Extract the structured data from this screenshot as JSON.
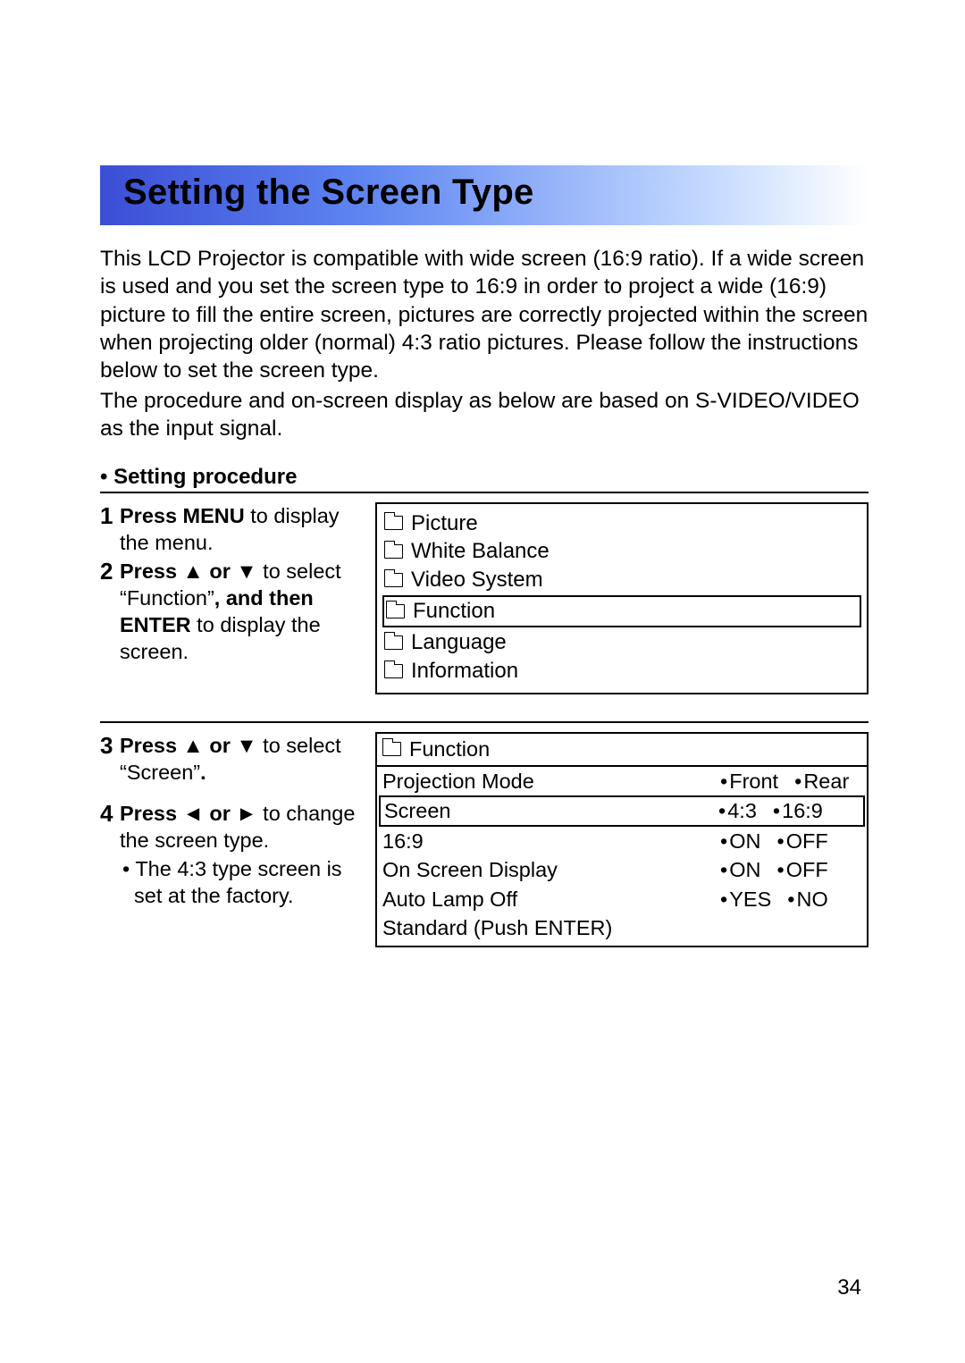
{
  "title": "Setting the Screen Type",
  "intro": "This LCD Projector is compatible with wide screen (16:9 ratio). If a wide screen is used and you set the screen type to 16:9 in order to project a wide (16:9) picture to fill the entire screen, pictures are correctly projected within the screen when projecting older (normal) 4:3 ratio pictures. Please follow the instructions below to set the screen type.",
  "intro2": "The procedure and on-screen display as below are based on S-VIDEO/VIDEO as the input signal.",
  "procedure_head": "• Setting procedure",
  "step1_num": "1",
  "step1_bold": "Press MENU",
  "step1_rest": " to display the menu.",
  "step2_num": "2",
  "step2_bold1": "Press ▲ or ▼",
  "step2_mid1": " to select “Function”",
  "step2_bold2": ", and then ENTER",
  "step2_mid2": " to display the screen.",
  "step3_num": "3",
  "step3_bold": "Press ▲ or ▼",
  "step3_rest": " to select “Screen”",
  "step3_dot": ".",
  "step4_num": "4",
  "step4_bold": "Press ◄ or ►",
  "step4_rest": " to change the screen type.",
  "step4_note": "• The 4:3 type screen is set at the factory.",
  "menu1": {
    "0": "Picture",
    "1": "White Balance",
    "2": "Video System",
    "3": "Function",
    "4": "Language",
    "5": "Information"
  },
  "menu2": {
    "head": "Function",
    "r0_label": "Projection Mode",
    "r0_o1": "Front",
    "r0_o2": "Rear",
    "r1_label": "Screen",
    "r1_o1": "4:3",
    "r1_o2": "16:9",
    "r2_label": "16:9",
    "r2_o1": "ON",
    "r2_o2": "OFF",
    "r3_label": "On Screen Display",
    "r3_o1": "ON",
    "r3_o2": "OFF",
    "r4_label": "Auto Lamp Off",
    "r4_o1": "YES",
    "r4_o2": "NO",
    "r5_label": "Standard (Push ENTER)"
  },
  "page_number": "34"
}
